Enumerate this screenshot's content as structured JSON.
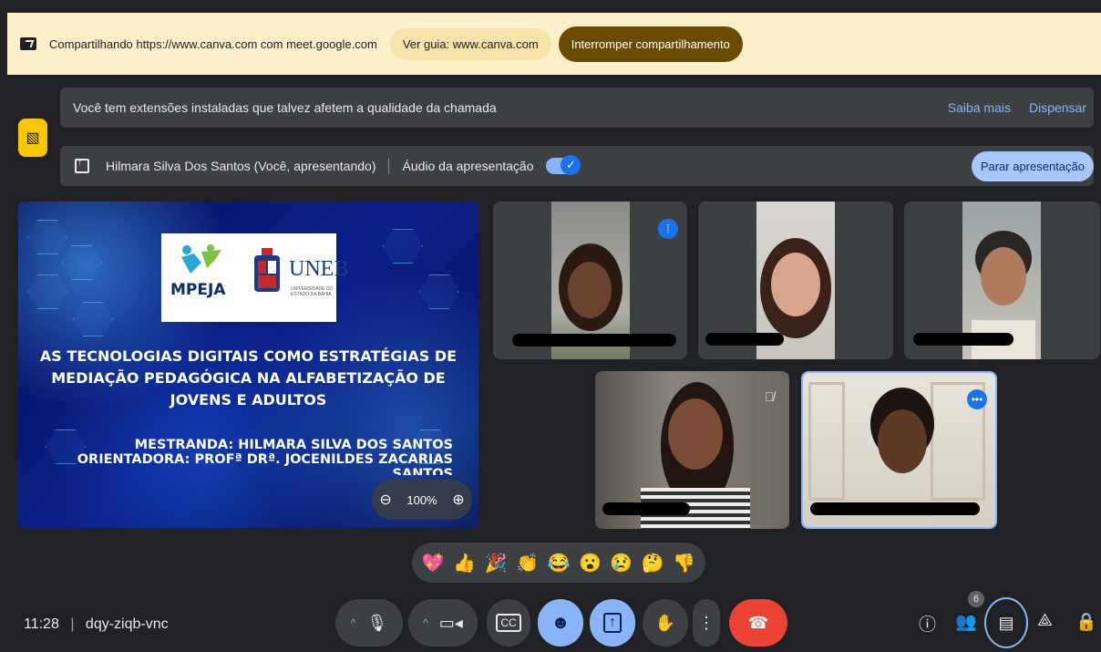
{
  "share_bar": {
    "sharing_text": "Compartilhando https://www.canva.com com meet.google.com",
    "view_guide_label": "Ver guia: www.canva.com",
    "stop_sharing_label": "Interromper compartilhamento"
  },
  "notice": {
    "text": "Você tem extensões instaladas que talvez afetem a qualidade da chamada",
    "learn_more": "Saiba mais",
    "dismiss": "Dispensar"
  },
  "presenting": {
    "presenter": "Hilmara Silva Dos Santos (Você, apresentando)",
    "audio_label": "Áudio da apresentação",
    "audio_on": true,
    "stop_label": "Parar apresentação"
  },
  "slide": {
    "logo_text": "MPEJA",
    "university": "UNEB",
    "university_sub": "UNIVERSIDADE DO ESTADO DA BAHIA",
    "title_lines": [
      "AS TECNOLOGIAS DIGITAIS COMO ESTRATÉGIAS DE",
      "MEDIAÇÃO PEDAGÓGICA NA ALFABETIZAÇÃO DE",
      "JOVENS E ADULTOS"
    ],
    "student": "MESTRANDA: HILMARA SILVA DOS SANTOS",
    "advisor": "ORIENTADORA: PROFª DRª. JOCENILDES ZACARIAS",
    "advisor_cont": "SANTOS",
    "zoom_level": "100%"
  },
  "reactions": [
    "💖",
    "👍",
    "🎉",
    "👏",
    "😂",
    "😮",
    "😢",
    "🤔",
    "👎"
  ],
  "bottom_bar": {
    "time": "11:28",
    "meeting_code": "dqy-ziqb-vnc",
    "participant_count": "6"
  },
  "colors": {
    "background": "#202124",
    "banner": "#fdefc8",
    "stop_share": "#6a4b00",
    "accent_blue": "#8ab4f8",
    "end_call": "#ea4335"
  }
}
